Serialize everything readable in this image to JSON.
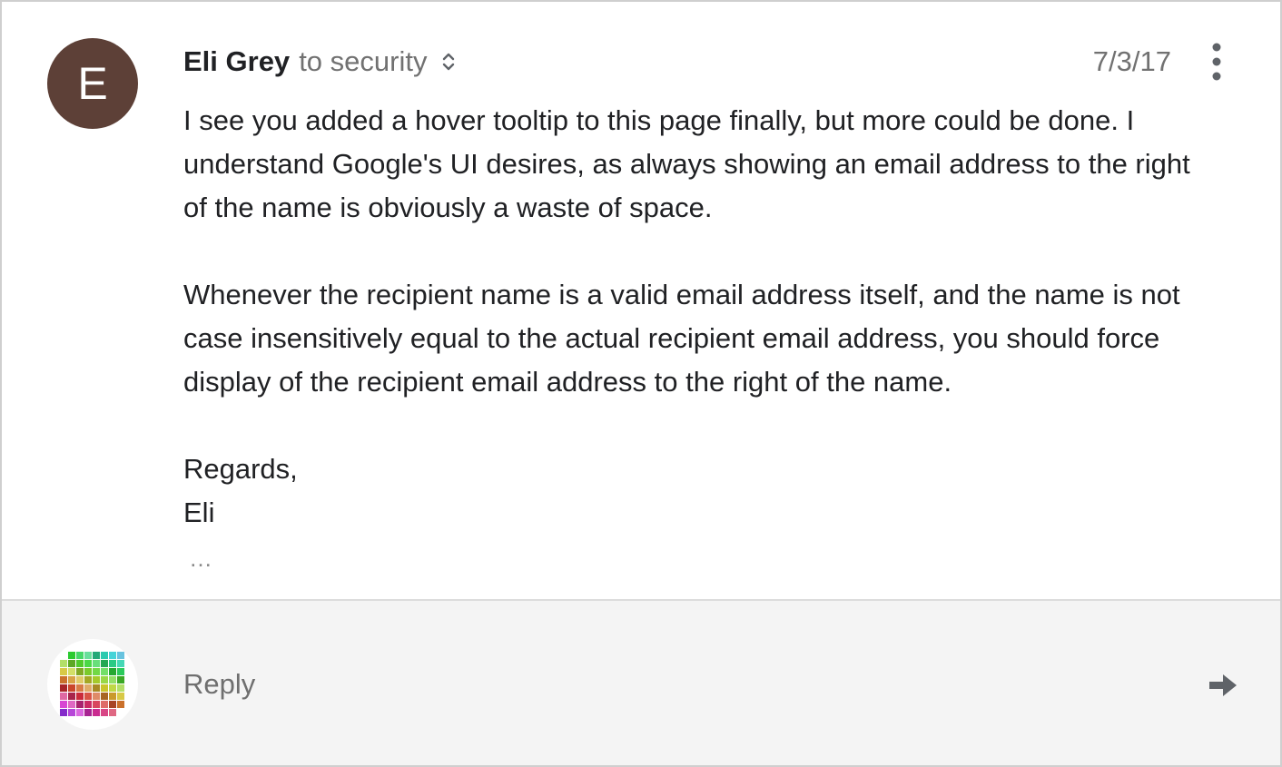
{
  "message": {
    "avatar_letter": "E",
    "avatar_color": "#5d4037",
    "sender": "Eli Grey",
    "recipients": "to security",
    "date": "7/3/17",
    "body": {
      "p1": "I see you added a hover tooltip to this page finally, but more could be done. I understand Google's UI desires, as always showing an email address to the right of the name is obviously a waste of space.",
      "p2": "Whenever the recipient name is a valid email address itself, and the name is not case insensitively equal to the actual recipient email address, you should force display of the recipient email address to the right of the name.",
      "closing": "Regards,",
      "signature": "Eli"
    },
    "trimmed_content": "…"
  },
  "reply": {
    "placeholder": "Reply"
  },
  "icons": {
    "expand": "unfold-more-icon",
    "more": "more-vert-icon",
    "send": "arrow-right-icon",
    "self_avatar": "pixel-mosaic-avatar"
  },
  "colors": {
    "text": "#202124",
    "muted": "#717171",
    "reply_bar_bg": "#f4f4f4"
  }
}
